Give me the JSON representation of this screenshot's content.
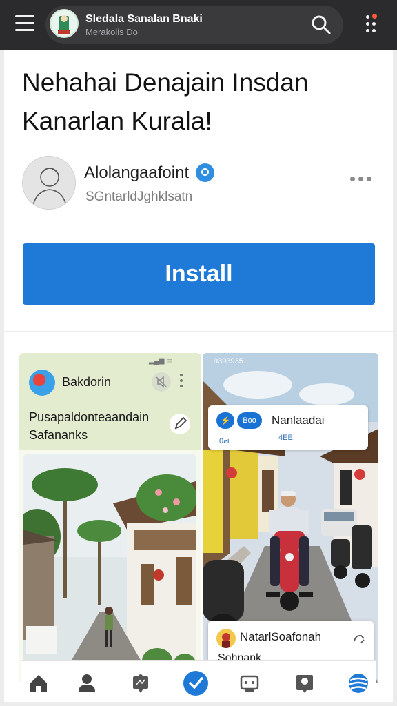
{
  "top_bar": {
    "app_title": "Sledala Sanalan Bnaki",
    "app_subtitle": "Merakolis Do"
  },
  "listing": {
    "headline": "Nehahai Denajain Insdan Kanarlan Kurala!",
    "developer_name": "Alolangaafoint",
    "developer_handle": "SGntarldJghklsatn",
    "install_label": "Install"
  },
  "screenshot_one": {
    "status": "▂▄▆ ▭",
    "app_name": "Bakdorin",
    "title_line1": "Pusapaldonteaandain",
    "title_line2": "Safanank",
    "title_mark": "s"
  },
  "screenshot_two": {
    "status": "9393935",
    "chip1": "⚡",
    "chip2": "Boo",
    "title": "Nanlaadai",
    "meta1": "0๗",
    "meta2": "4EE",
    "bottom_title": "NatarlSoafonah",
    "bottom_sub": "Sohnank"
  },
  "icons": {
    "menu": "menu-icon",
    "search": "search-icon",
    "more": "more-vertical-icon"
  },
  "colors": {
    "install_blue": "#1e7ad6",
    "verified_blue": "#2f8ee0",
    "top_bar": "#2b2b2d"
  }
}
